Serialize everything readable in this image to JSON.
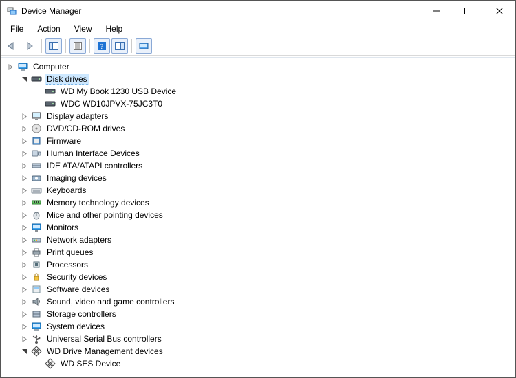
{
  "window": {
    "title": "Device Manager"
  },
  "menu": {
    "file": "File",
    "action": "Action",
    "view": "View",
    "help": "Help"
  },
  "toolbar": {
    "back": "back",
    "forward": "forward",
    "show_hide_tree": "show-hide-console-tree",
    "properties": "properties",
    "help": "help",
    "show_hide_action": "show-hide-action-pane",
    "scan": "scan-for-hardware-changes"
  },
  "tree": {
    "root": {
      "label": "Computer",
      "icon": "computer-icon"
    },
    "nodes": [
      {
        "label": "Disk drives",
        "icon": "disk-icon",
        "expanded": true,
        "selected": true,
        "children": [
          {
            "label": "WD My Book 1230 USB Device",
            "icon": "disk-icon"
          },
          {
            "label": "WDC WD10JPVX-75JC3T0",
            "icon": "disk-icon"
          }
        ]
      },
      {
        "label": "Display adapters",
        "icon": "display-icon",
        "expanded": false
      },
      {
        "label": "DVD/CD-ROM drives",
        "icon": "optical-icon",
        "expanded": false
      },
      {
        "label": "Firmware",
        "icon": "firmware-icon",
        "expanded": false
      },
      {
        "label": "Human Interface Devices",
        "icon": "hid-icon",
        "expanded": false
      },
      {
        "label": "IDE ATA/ATAPI controllers",
        "icon": "ide-icon",
        "expanded": false
      },
      {
        "label": "Imaging devices",
        "icon": "imaging-icon",
        "expanded": false
      },
      {
        "label": "Keyboards",
        "icon": "keyboard-icon",
        "expanded": false
      },
      {
        "label": "Memory technology devices",
        "icon": "memory-icon",
        "expanded": false
      },
      {
        "label": "Mice and other pointing devices",
        "icon": "mouse-icon",
        "expanded": false
      },
      {
        "label": "Monitors",
        "icon": "monitor-icon",
        "expanded": false
      },
      {
        "label": "Network adapters",
        "icon": "network-icon",
        "expanded": false
      },
      {
        "label": "Print queues",
        "icon": "printer-icon",
        "expanded": false
      },
      {
        "label": "Processors",
        "icon": "cpu-icon",
        "expanded": false
      },
      {
        "label": "Security devices",
        "icon": "security-icon",
        "expanded": false
      },
      {
        "label": "Software devices",
        "icon": "software-icon",
        "expanded": false
      },
      {
        "label": "Sound, video and game controllers",
        "icon": "sound-icon",
        "expanded": false
      },
      {
        "label": "Storage controllers",
        "icon": "storage-icon",
        "expanded": false
      },
      {
        "label": "System devices",
        "icon": "system-icon",
        "expanded": false
      },
      {
        "label": "Universal Serial Bus controllers",
        "icon": "usb-icon",
        "expanded": false
      },
      {
        "label": "WD Drive Management devices",
        "icon": "wd-icon",
        "expanded": true,
        "children": [
          {
            "label": "WD SES Device",
            "icon": "wd-icon"
          }
        ]
      }
    ]
  }
}
